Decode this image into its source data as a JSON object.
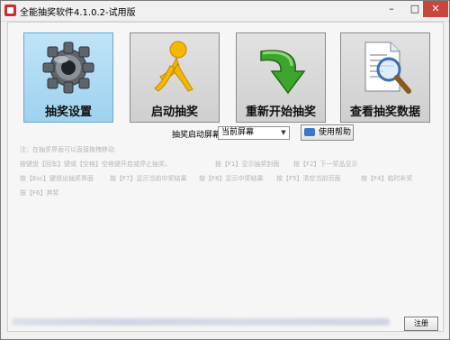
{
  "window": {
    "title": "全能抽奖软件4.1.0.2-试用版",
    "minimize_glyph": "–",
    "maximize_glyph": "□",
    "close_glyph": "✕"
  },
  "tiles": [
    {
      "label": "抽奖设置",
      "icon": "gear-icon",
      "active": true
    },
    {
      "label": "启动抽奖",
      "icon": "running-person-icon",
      "active": false
    },
    {
      "label": "重新开始抽奖",
      "icon": "restart-arrow-icon",
      "active": false
    },
    {
      "label": "查看抽奖数据",
      "icon": "document-magnifier-icon",
      "active": false
    }
  ],
  "screen": {
    "label": "抽奖启动屏幕",
    "value": "当前屏幕"
  },
  "help_button": "使用帮助",
  "notes": [
    "注：在抽奖界面可以直接拖拽移动",
    "按键盘【回车】键或【空格】空格键开启或停止抽奖。",
    "按【F1】显示抽奖封面",
    "按【F2】下一奖品显示",
    "按【Esc】键退出抽奖界面",
    "按【F7】显示当前中奖结果",
    "按【F8】显示中奖结果",
    "按【F5】清空当前页面",
    "按【F4】临时补奖",
    "按【F6】弃奖"
  ],
  "ok_button": "注册",
  "colors": {
    "active_tile": "#9fd1ef",
    "tile": "#d8d8d8",
    "close_button": "#c9463d"
  }
}
